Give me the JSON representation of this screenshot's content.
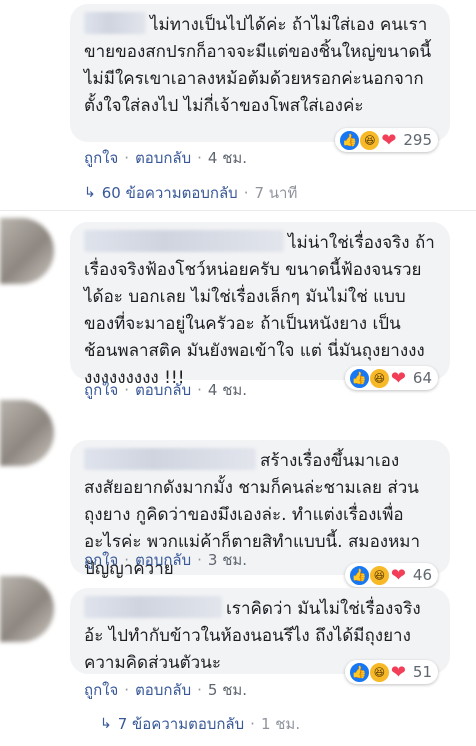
{
  "comments": [
    {
      "text": "ไม่ทางเป็นไปได้ค่ะ ถ้าไม่ใส่เอง คนเราขายของสกปรกก็อาจจะมีแต่ของชิ้นใหญ่ขนาดนี้ไม่มีใครเขาเอาลงหม้อต้มด้วยหรอกค่ะนอกจากตั้งใจใส่ลงไป ไม่กี่เจ้าของโพสใส่เองค่ะ",
      "reaction_count": "295",
      "like_label": "ถูกใจ",
      "reply_label": "ตอบกลับ",
      "time": "4 ชม."
    },
    {
      "text": "ไม่น่าใช่เรื่องจริง ถ้าเรื่องจริงฟ้องโชว์หน่อยครับ ขนาดนี้ฟ้องจนรวยได้อะ บอกเลย ไม่ใช่เรื่องเล็กๆ มันไม่ใช่ แบบ ของที่จะมาอยู่ในครัวอะ ถ้าเป็นหนังยาง เป็น ช้อนพลาสติค มันยังพอเข้าใจ แต่ นี่มันถุงยางงงงงงงงงงงง !!!",
      "reaction_count": "64",
      "like_label": "ถูกใจ",
      "reply_label": "ตอบกลับ",
      "time": "4 ชม."
    },
    {
      "text": "สร้างเรื่องขึ้นมาเอง สงสัยอยากดังมากมั้ง ชามก็คนล่ะชามเลย ส่วนถุงยาง กูคิดว่าของมึงเองล่ะ. ทำแต่งเรื่องเพื่ออะไรค่ะ พวกแม่ค้าก็ตายสิทำแบบนี้. สมองหมาปัญญาควาย",
      "reaction_count": "46",
      "like_label": "ถูกใจ",
      "reply_label": "ตอบกลับ",
      "time": "3 ชม."
    },
    {
      "text": "เราคิดว่า มันไม่ใช่เรื่องจริงอ้ะ ไปทำกับข้าวในห้องนอนรึไง ถึงได้มีถุงยาง ความคิดส่วนตัวนะ",
      "reaction_count": "51",
      "like_label": "ถูกใจ",
      "reply_label": "ตอบกลับ",
      "time": "5 ชม."
    }
  ],
  "reply_threads": [
    {
      "label": "60 ข้อความตอบกลับ",
      "time": "7 นาที"
    },
    {
      "label": "7 ข้อความตอบกลับ",
      "time": "1 ชม."
    }
  ],
  "colors": {
    "link": "#385898",
    "bubble": "#f2f3f5",
    "like": "#1877f2",
    "haha": "#f7b928",
    "love": "#f33e58"
  },
  "icons": [
    "like-reaction-icon",
    "haha-reaction-icon",
    "love-reaction-icon",
    "reply-arrow-icon"
  ]
}
